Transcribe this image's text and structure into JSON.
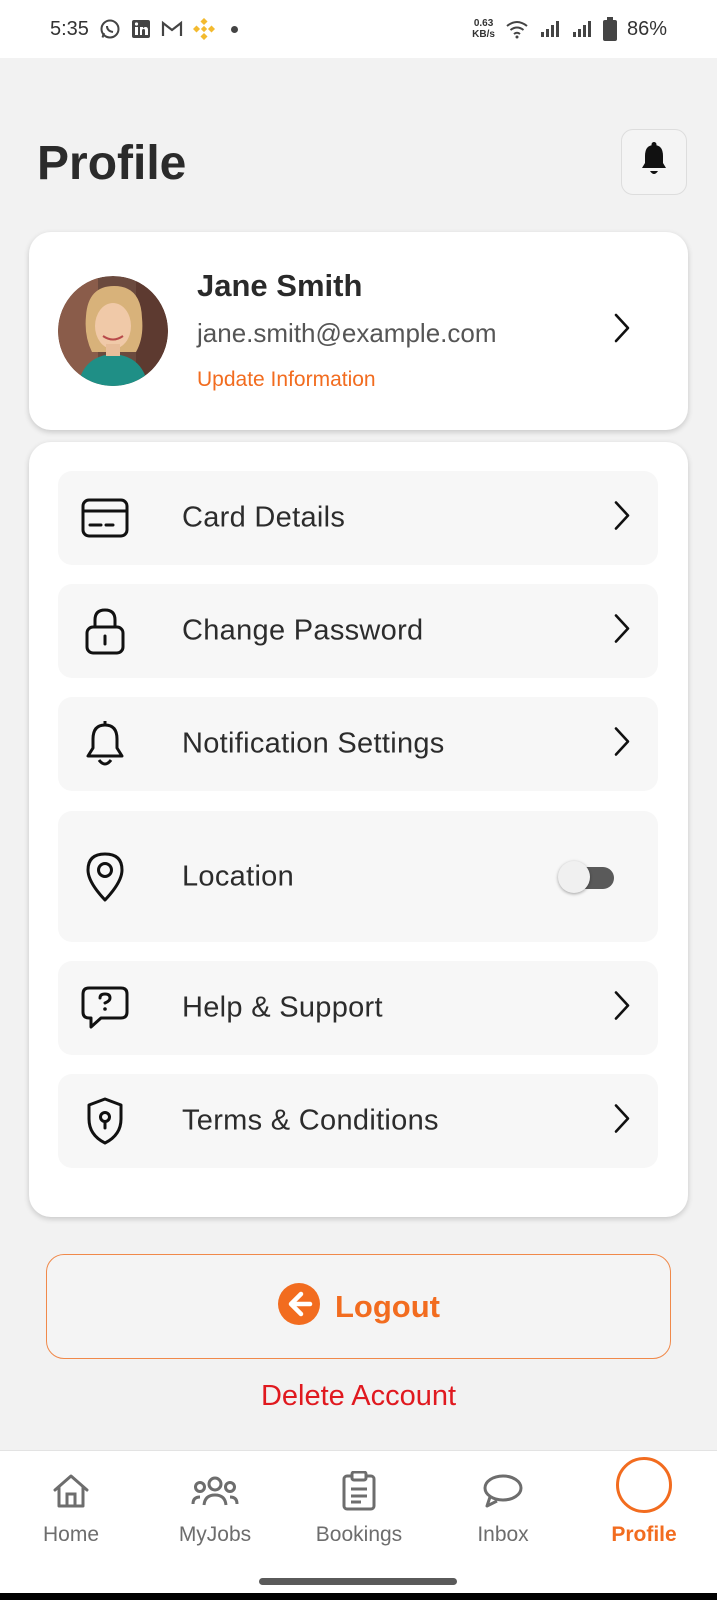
{
  "status_bar": {
    "time": "5:35",
    "speed_value": "0.63",
    "speed_unit": "KB/s",
    "battery": "86%",
    "icons": [
      "whatsapp-icon",
      "linkedin-icon",
      "gmail-icon",
      "binance-icon",
      "wifi-icon",
      "signal-icon",
      "battery-icon"
    ]
  },
  "header": {
    "title": "Profile",
    "bell_icon": "bell-icon"
  },
  "profile": {
    "name": "Jane Smith",
    "email": "jane.smith@example.com",
    "update_link": "Update Information"
  },
  "menu": {
    "items": [
      {
        "label": "Card Details",
        "icon": "card-icon"
      },
      {
        "label": "Change Password",
        "icon": "lock-icon"
      },
      {
        "label": "Notification Settings",
        "icon": "bell-icon"
      },
      {
        "label": "Location",
        "icon": "location-pin-icon",
        "toggle_on": false
      },
      {
        "label": "Help & Support",
        "icon": "help-chat-icon"
      },
      {
        "label": "Terms & Conditions",
        "icon": "shield-icon"
      }
    ]
  },
  "actions": {
    "logout_label": "Logout",
    "delete_label": "Delete Account"
  },
  "bottom_nav": {
    "items": [
      {
        "label": "Home",
        "icon": "home-icon"
      },
      {
        "label": "MyJobs",
        "icon": "users-icon"
      },
      {
        "label": "Bookings",
        "icon": "clipboard-icon"
      },
      {
        "label": "Inbox",
        "icon": "chat-icon"
      },
      {
        "label": "Profile",
        "icon": "profile-ring-icon",
        "active": true
      }
    ]
  },
  "colors": {
    "accent": "#f26c1f",
    "danger": "#e0191f",
    "background": "#f2f2f2"
  }
}
